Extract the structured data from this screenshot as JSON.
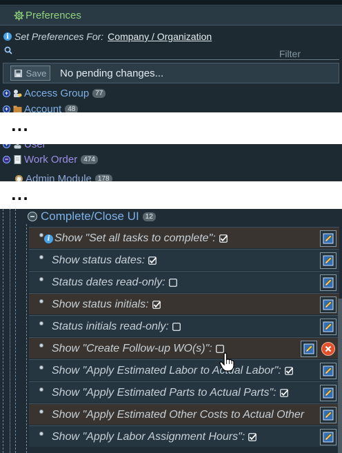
{
  "panel": {
    "title": "Preferences",
    "title_icon": "gear-icon",
    "set_for_label": "Set Preferences For:",
    "set_for_value": "Company / Organization",
    "filter_placeholder": "Filter",
    "save_label": "Save",
    "pending_text": "No pending changes..."
  },
  "tree_top": [
    {
      "label": "Access Group",
      "count": "77",
      "icon": "key-group-icon"
    },
    {
      "label": "Account",
      "count": "48",
      "icon": "folder-icon"
    }
  ],
  "ellipsis": "...",
  "tree_mid": [
    {
      "label": "User",
      "count": "",
      "icon": "user-icon"
    },
    {
      "label": "Work Order",
      "count": "474",
      "icon": "document-icon"
    },
    {
      "label": "Admin Module",
      "count": "178",
      "icon": "module-icon"
    }
  ],
  "group": {
    "label": "Complete/Close UI",
    "count": "12"
  },
  "settings": [
    {
      "label": "Show \"Set all tasks to complete\":",
      "checked": true,
      "info": true
    },
    {
      "label": "Show status dates:",
      "checked": true,
      "info": false
    },
    {
      "label": "Status dates read-only:",
      "checked": false,
      "info": false
    },
    {
      "label": "Show status initials:",
      "checked": true,
      "info": false
    },
    {
      "label": "Status initials read-only:",
      "checked": false,
      "info": false
    },
    {
      "label": "Show \"Create Follow-up WO(s)\":",
      "checked": false,
      "info": false,
      "deletable": true
    },
    {
      "label": "Show \"Apply Estimated Labor to Actual Labor\":",
      "checked": true,
      "info": false
    },
    {
      "label": "Show \"Apply Estimated Parts to Actual Parts\":",
      "checked": true,
      "info": false
    },
    {
      "label": "Show \"Apply Estimated Other Costs to Actual Other",
      "checked": null,
      "info": false
    },
    {
      "label": "Show \"Apply Labor Assignment Hours\":",
      "checked": true,
      "info": false
    }
  ],
  "colors": {
    "title_text": "#8fd17a",
    "link_text": "#7fb0e6",
    "row_dark": "#253640",
    "row_brown": "#3a3430",
    "delete": "#e0502a"
  }
}
